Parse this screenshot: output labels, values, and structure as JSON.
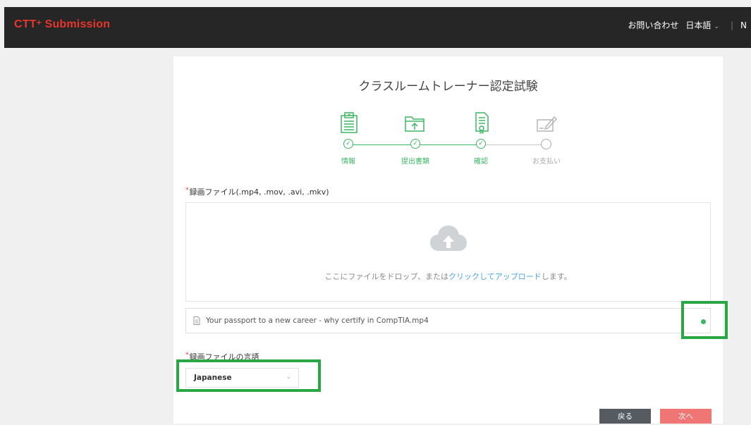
{
  "header": {
    "brand_main": "CTT",
    "brand_plus": "+",
    "brand_suffix": " Submission",
    "contact_label": "お問い合わせ",
    "language_label": "日本語",
    "user_initial": "N"
  },
  "page": {
    "title": "クラスルームトレーナー認定試験"
  },
  "steps": [
    {
      "label": "情報",
      "status": "done",
      "icon": "certificate-icon"
    },
    {
      "label": "提出書類",
      "status": "done",
      "icon": "folder-upload-icon"
    },
    {
      "label": "確認",
      "status": "done",
      "icon": "document-check-icon"
    },
    {
      "label": "お支払い",
      "status": "pending",
      "icon": "sign-document-icon"
    }
  ],
  "video_field": {
    "label": "録画ファイル(.mp4, .mov, .avi, .mkv)",
    "required_mark": "*",
    "drop_text_before": "ここにファイルをドロップ、または",
    "drop_text_link": "クリックしてアップロード",
    "drop_text_after": "します。",
    "uploaded_file": "Your passport to a new career - why certify in CompTIA.mp4",
    "upload_status": "complete"
  },
  "language_field": {
    "label": "録画ファイルの言語",
    "required_mark": "*",
    "selected": "Japanese"
  },
  "actions": {
    "back_label": "戻る",
    "next_label": "次へ"
  },
  "colors": {
    "brand_red": "#e8362d",
    "step_green": "#3cb763",
    "highlight_green": "#29a745",
    "link_blue": "#4aa3e8",
    "next_button": "#f07575",
    "back_button": "#555b61"
  }
}
